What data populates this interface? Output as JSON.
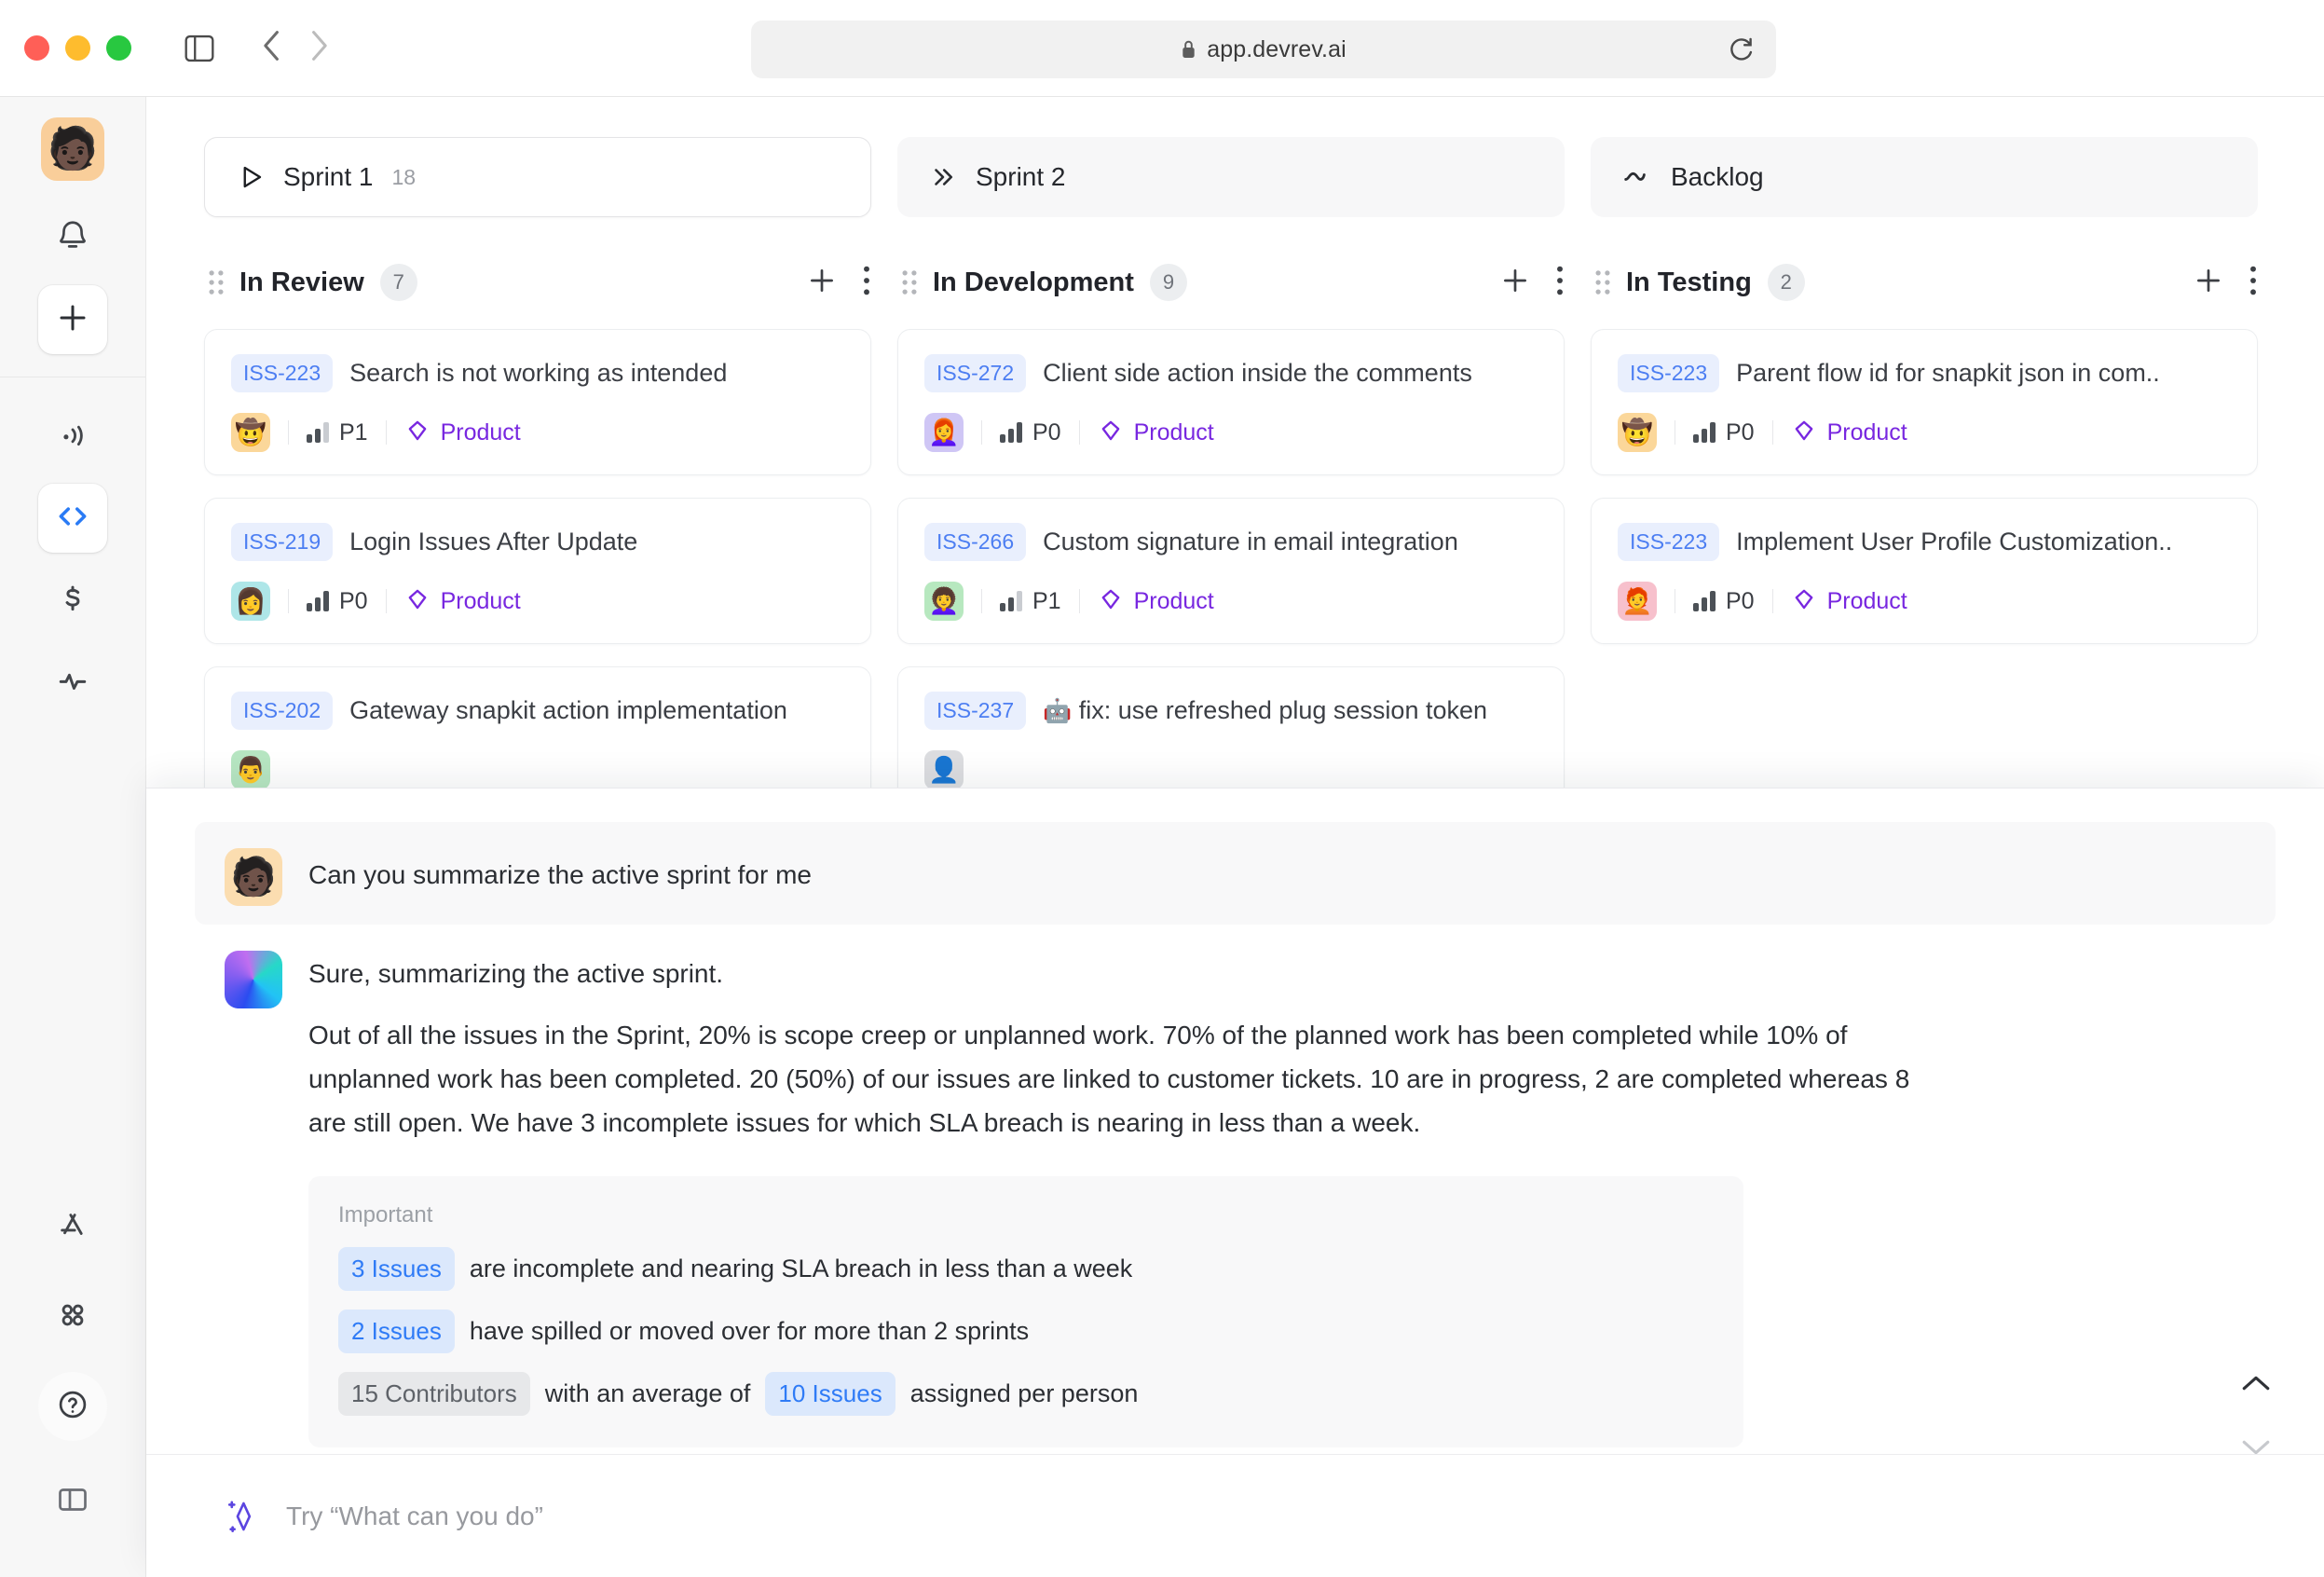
{
  "browser": {
    "url": "app.devrev.ai",
    "icons": {
      "sidebar_toggle": "sidebar-toggle-icon",
      "back": "back-arrow-icon",
      "forward": "forward-arrow-icon",
      "lock": "lock-icon",
      "reload": "reload-icon"
    }
  },
  "rail": {
    "avatar_emoji": "🧑🏿",
    "items": [
      {
        "name": "notifications",
        "icon": "bell-icon"
      },
      {
        "name": "create",
        "icon": "plus-icon"
      },
      {
        "name": "broadcast",
        "icon": "broadcast-icon"
      },
      {
        "name": "build",
        "icon": "code-brackets-icon"
      },
      {
        "name": "revenue",
        "icon": "dollar-icon"
      },
      {
        "name": "analytics",
        "icon": "pulse-icon"
      },
      {
        "name": "apps",
        "icon": "appstore-icon"
      },
      {
        "name": "grid",
        "icon": "four-dots-icon"
      },
      {
        "name": "help",
        "icon": "question-circle-icon"
      },
      {
        "name": "panel-toggle",
        "icon": "panel-layout-icon"
      }
    ]
  },
  "sprint_tabs": [
    {
      "label": "Sprint 1",
      "count": "18",
      "icon": "play-icon",
      "active": true
    },
    {
      "label": "Sprint 2",
      "count": "",
      "icon": "double-chevron-right-icon",
      "active": false
    },
    {
      "label": "Backlog",
      "count": "",
      "icon": "wave-icon",
      "active": false
    }
  ],
  "columns": [
    {
      "title": "In Review",
      "count": "7",
      "cards": [
        {
          "id": "ISS-223",
          "title": "Search is not working as intended",
          "emoji": "",
          "avatar": "🤠",
          "avatar_bg": "#fbd79a",
          "priority": "P1",
          "part": "Product"
        },
        {
          "id": "ISS-219",
          "title": "Login Issues After Update",
          "emoji": "",
          "avatar": "👩",
          "avatar_bg": "#aee6e8",
          "priority": "P0",
          "part": "Product"
        },
        {
          "id": "ISS-202",
          "title": "Gateway snapkit action implementation",
          "emoji": "",
          "avatar": "👨",
          "avatar_bg": "#b7e6c2",
          "priority": "",
          "part": ""
        }
      ]
    },
    {
      "title": "In Development",
      "count": "9",
      "cards": [
        {
          "id": "ISS-272",
          "title": "Client side action inside the comments",
          "emoji": "",
          "avatar": "👩‍🦰",
          "avatar_bg": "#cfc6f5",
          "priority": "P0",
          "part": "Product"
        },
        {
          "id": "ISS-266",
          "title": "Custom signature in email integration",
          "emoji": "",
          "avatar": "👩‍🦱",
          "avatar_bg": "#b7e8bf",
          "priority": "P1",
          "part": "Product"
        },
        {
          "id": "ISS-237",
          "title": "fix: use refreshed plug session token",
          "emoji": "🤖",
          "avatar": "👤",
          "avatar_bg": "#dcdde0",
          "priority": "",
          "part": ""
        }
      ]
    },
    {
      "title": "In Testing",
      "count": "2",
      "cards": [
        {
          "id": "ISS-223",
          "title": "Parent flow id for snapkit json in com..",
          "emoji": "",
          "avatar": "🤠",
          "avatar_bg": "#fbd79a",
          "priority": "P0",
          "part": "Product"
        },
        {
          "id": "ISS-223",
          "title": "Implement User Profile Customization..",
          "emoji": "",
          "avatar": "🧑‍🦰",
          "avatar_bg": "#f7c0cc",
          "priority": "P0",
          "part": "Product"
        }
      ]
    }
  ],
  "column_actions": {
    "add": "plus-icon",
    "more": "more-vertical-icon",
    "grip": "drag-grip-icon"
  },
  "chat": {
    "user": {
      "avatar_emoji": "🧑🏿",
      "message": "Can you summarize the active sprint for me"
    },
    "bot": {
      "intro": "Sure, summarizing the active sprint.",
      "paragraph": "Out of all the issues in the Sprint, 20% is scope creep or unplanned work. 70% of the planned work has been completed while 10% of unplanned work has been completed. 20 (50%) of our issues are linked to customer tickets. 10 are in progress, 2 are completed whereas 8 are still open. We have 3 incomplete issues for which SLA breach is nearing in less than a week.",
      "callout": {
        "title": "Important",
        "rows": [
          {
            "chip": "3 Issues",
            "chip_style": "blue",
            "text": "are incomplete and nearing SLA breach in less than a week"
          },
          {
            "chip": "2 Issues",
            "chip_style": "blue",
            "text": "have spilled or moved over for more than 2 sprints"
          },
          {
            "chip": "15 Contributors",
            "chip_style": "grey",
            "text": "with an average of",
            "chip2": "10 Issues",
            "text2": "assigned per person"
          }
        ]
      }
    },
    "input_placeholder": "Try “What can you do”",
    "icons": {
      "collapse": "collapse-corners-icon",
      "chevron_up": "chevron-up-icon",
      "chevron_down": "chevron-down-icon",
      "sparkle": "sparkle-icon"
    }
  },
  "colors": {
    "accent_blue": "#4c7ef2",
    "chip_blue_bg": "#dbe8fc",
    "chip_blue_text": "#2f7bf6",
    "part_purple": "#7827e0",
    "badge_bg": "#e9effd"
  }
}
